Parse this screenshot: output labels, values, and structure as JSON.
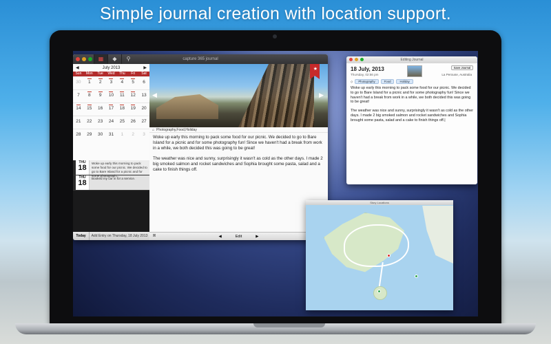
{
  "headline": "Simple journal creation with location support.",
  "main_window": {
    "title": "capture 365 journal",
    "calendar": {
      "month_label": "July 2013",
      "prev": "◀",
      "next": "▶",
      "dows": [
        "Sun",
        "Mon",
        "Tue",
        "Wed",
        "Thu",
        "Fri",
        "Sat"
      ],
      "days": [
        {
          "d": "30",
          "out": true,
          "mark": false
        },
        {
          "d": "1",
          "out": false,
          "mark": true
        },
        {
          "d": "2",
          "out": false,
          "mark": true
        },
        {
          "d": "3",
          "out": false,
          "mark": true
        },
        {
          "d": "4",
          "out": false,
          "mark": true
        },
        {
          "d": "5",
          "out": false,
          "mark": true
        },
        {
          "d": "6",
          "out": false,
          "mark": false
        },
        {
          "d": "7",
          "out": false,
          "mark": false
        },
        {
          "d": "8",
          "out": false,
          "mark": true
        },
        {
          "d": "9",
          "out": false,
          "mark": true
        },
        {
          "d": "10",
          "out": false,
          "mark": true
        },
        {
          "d": "11",
          "out": false,
          "mark": true
        },
        {
          "d": "12",
          "out": false,
          "mark": true
        },
        {
          "d": "13",
          "out": false,
          "mark": false
        },
        {
          "d": "14",
          "out": false,
          "mark": true
        },
        {
          "d": "15",
          "out": false,
          "mark": true
        },
        {
          "d": "16",
          "out": false,
          "mark": false
        },
        {
          "d": "17",
          "out": false,
          "mark": true
        },
        {
          "d": "18",
          "out": false,
          "mark": true
        },
        {
          "d": "19",
          "out": false,
          "mark": true
        },
        {
          "d": "20",
          "out": false,
          "mark": false
        },
        {
          "d": "21",
          "out": false,
          "mark": false
        },
        {
          "d": "22",
          "out": false,
          "mark": false
        },
        {
          "d": "23",
          "out": false,
          "mark": false
        },
        {
          "d": "24",
          "out": false,
          "mark": false
        },
        {
          "d": "25",
          "out": false,
          "mark": false
        },
        {
          "d": "26",
          "out": false,
          "mark": false
        },
        {
          "d": "27",
          "out": false,
          "mark": false
        },
        {
          "d": "28",
          "out": false,
          "mark": false
        },
        {
          "d": "29",
          "out": false,
          "mark": false
        },
        {
          "d": "30",
          "out": false,
          "mark": false
        },
        {
          "d": "31",
          "out": false,
          "mark": false
        },
        {
          "d": "1",
          "out": true,
          "mark": false
        },
        {
          "d": "2",
          "out": true,
          "mark": false
        },
        {
          "d": "3",
          "out": true,
          "mark": false
        }
      ]
    },
    "entries": [
      {
        "dow": "THU",
        "day": "18",
        "text": "Woke up early this morning to pack some food for our picnic. We decided to go to Bare Island for a picnic and for some photograph..."
      },
      {
        "dow": "THU",
        "day": "18",
        "text": "Booked my car in for a service."
      }
    ],
    "footer": {
      "today": "Today",
      "add": "Add Entry on Thursday, 18 July 2013"
    },
    "photo": {
      "nav_left": "◀",
      "nav_right": "▶",
      "bookmark": "★"
    },
    "tags": "Photography,Food,Holiday",
    "body": [
      "Woke up early this morning to pack some food for our picnic. We decided to go to Bare Island for a picnic and for some photography fun! Since we haven't had a break from work in a while, we both decided this was going to be great!",
      "The weather was nice and sunny, surprisingly it wasn't as cold as the other days. I made 2 big smoked salmon and rocket sandwiches and Sophia brought some pasta, salad and a cake to finish things off."
    ],
    "content_footer": {
      "prev": "◀",
      "edit": "Edit",
      "next": "▶"
    }
  },
  "edit_window": {
    "title": "Editing Journal",
    "date": "18 July, 2013",
    "time": "Thursday, 02:56 pm",
    "save": "Save Journal",
    "location": "La Perouse, Australia",
    "tags": [
      "Photography",
      "Food",
      "Holiday"
    ],
    "body": [
      "Woke up early this morning to pack some food for our picnic. We decided to go to Bare Island for a picnic and for some photography fun! Since we haven't had a break from work in a while, we both decided this was going to be great!",
      "The weather was nice and sunny, surprisingly it wasn't as cold as the other days. I made 2 big smoked salmon and rocket sandwiches and Sophia brought some pasta, salad and a cake to finish things off.|"
    ]
  },
  "map_window": {
    "title": "Story Locations"
  },
  "icons": {
    "calendar": "calendar-icon",
    "tag": "tag-icon",
    "search": "search-icon",
    "camera": "camera-icon",
    "trash": "trash-icon"
  },
  "colors": {
    "accent_red": "#c72a2a",
    "cal_header": "#b22a2a",
    "tag_blue": "#d7e6f7"
  }
}
